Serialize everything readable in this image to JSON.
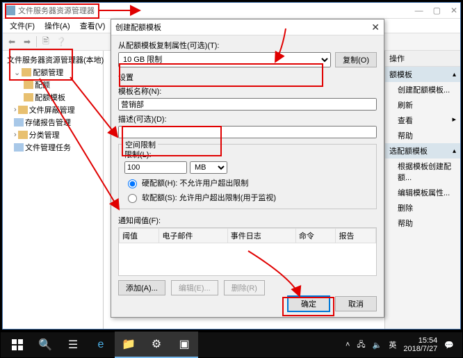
{
  "window": {
    "title": "文件服务器资源管理器",
    "menu": {
      "file": "文件(F)",
      "action": "操作(A)",
      "view": "查看(V)",
      "help": "帮助(H)"
    }
  },
  "tree": {
    "root": "文件服务器资源管理器(本地)",
    "n1": "配额管理",
    "n1a": "配额",
    "n1b": "配额模板",
    "n2": "文件屏蔽管理",
    "n3": "存储报告管理",
    "n4": "分类管理",
    "n5": "文件管理任务"
  },
  "actions": {
    "header": "操作",
    "sect1": "额模板",
    "a1": "创建配额模板...",
    "a2": "刷新",
    "a3": "查看",
    "a4": "帮助",
    "sect2": "选配额模板",
    "b1": "根据模板创建配额...",
    "b2": "编辑模板属性...",
    "b3": "删除",
    "b4": "帮助"
  },
  "dlg": {
    "title": "创建配额模板",
    "copy_from": "从配额模板复制属性(可选)(T):",
    "copy_sel": "10 GB 限制",
    "copy_btn": "复制(O)",
    "settings": "设置",
    "name_lbl": "模板名称(N):",
    "name_val": "营销部",
    "desc_lbl": "描述(可选)(D):",
    "desc_val": "",
    "space_grp": "空间限制",
    "limit_lbl": "限制(L):",
    "limit_val": "100",
    "unit_sel": "MB",
    "hard": "硬配额(H): 不允许用户超出限制",
    "soft": "软配额(S): 允许用户超出限制(用于监视)",
    "notify_lbl": "通知阈值(F):",
    "col1": "阈值",
    "col2": "电子邮件",
    "col3": "事件日志",
    "col4": "命令",
    "col5": "报告",
    "add": "添加(A)...",
    "edit": "编辑(E)...",
    "del": "删除(R)",
    "ok": "确定",
    "cancel": "取消"
  },
  "taskbar": {
    "ime1": "英",
    "time": "15:54",
    "date": "2018/7/27"
  }
}
